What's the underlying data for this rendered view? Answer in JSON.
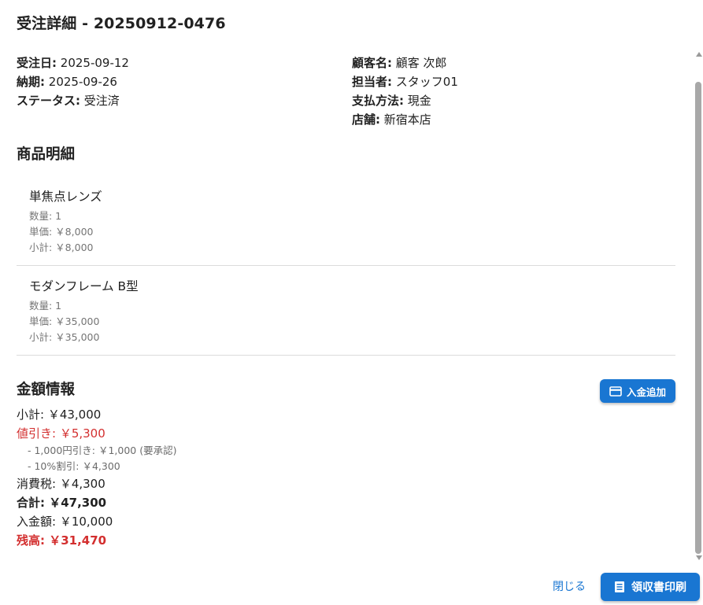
{
  "dialog": {
    "title": "受注詳細 - 20250912-0476"
  },
  "info": {
    "left": [
      {
        "label": "受注日:",
        "value": "2025-09-12"
      },
      {
        "label": "納期:",
        "value": "2025-09-26"
      },
      {
        "label": "ステータス:",
        "value": "受注済"
      }
    ],
    "right": [
      {
        "label": "顧客名:",
        "value": "顧客 次郎"
      },
      {
        "label": "担当者:",
        "value": "スタッフ01"
      },
      {
        "label": "支払方法:",
        "value": "現金"
      },
      {
        "label": "店舗:",
        "value": "新宿本店"
      }
    ]
  },
  "items_section": {
    "title": "商品明細",
    "items": [
      {
        "name": "単焦点レンズ",
        "qty": "数量: 1",
        "unit_price": "単価: ￥8,000",
        "subtotal": "小計: ￥8,000"
      },
      {
        "name": "モダンフレーム B型",
        "qty": "数量: 1",
        "unit_price": "単価: ￥35,000",
        "subtotal": "小計: ￥35,000"
      }
    ]
  },
  "amount_section": {
    "title": "金額情報",
    "add_payment_label": "入金追加",
    "subtotal": "小計: ￥43,000",
    "discount": "値引き: ￥5,300",
    "discount_details": [
      "- 1,000円引き: ￥1,000 (要承認)",
      "- 10%割引: ￥4,300"
    ],
    "tax": "消費税: ￥4,300",
    "total": "合計: ￥47,300",
    "paid": "入金額: ￥10,000",
    "balance": "残高: ￥31,470"
  },
  "footer": {
    "close_label": "閉じる",
    "print_label": "領収書印刷"
  },
  "colors": {
    "primary": "#1976d2",
    "danger": "#d32f2f"
  },
  "icons": {
    "payment": "credit-card-icon",
    "print": "receipt-icon"
  }
}
